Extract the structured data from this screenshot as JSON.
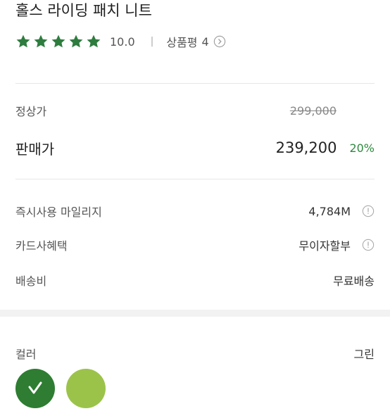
{
  "product": {
    "title": "홀스 라이딩 패치 니트",
    "rating_score": "10.0",
    "stars": 5,
    "review_label": "상품평",
    "review_count": "4",
    "star_color": "#2e7d3f"
  },
  "price": {
    "regular_label": "정상가",
    "regular_value": "299,000",
    "sale_label": "판매가",
    "sale_value": "239,200",
    "discount": "20%"
  },
  "benefits": [
    {
      "label": "즉시사용 마일리지",
      "value": "4,784M",
      "info": true
    },
    {
      "label": "카드사혜택",
      "value": "무이자할부",
      "info": true
    },
    {
      "label": "배송비",
      "value": "무료배송",
      "info": false
    }
  ],
  "color_option": {
    "label": "컬러",
    "selected": "그린",
    "swatches": [
      {
        "color": "#2e7d32",
        "selected": true,
        "icon": "check-icon"
      },
      {
        "color": "#9bc34a",
        "selected": false
      }
    ]
  }
}
